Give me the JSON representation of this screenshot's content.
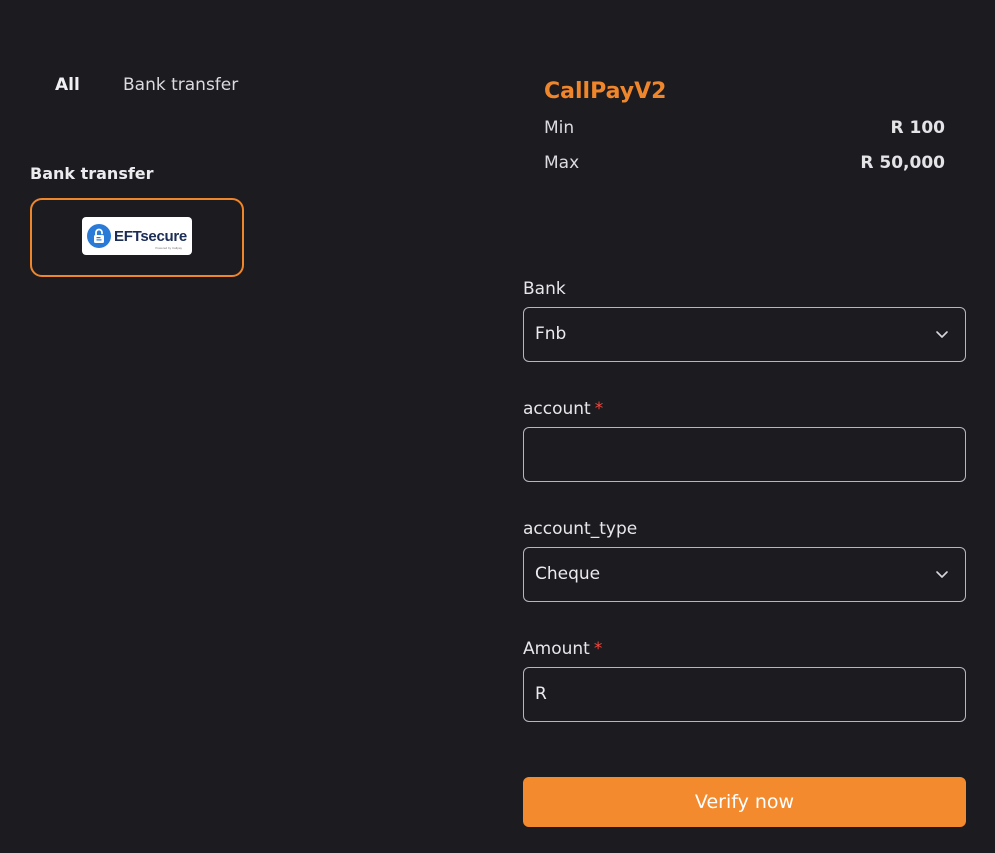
{
  "tabs": [
    {
      "label": "All"
    },
    {
      "label": "Bank transfer"
    }
  ],
  "methods_section": {
    "heading": "Bank transfer",
    "selected_method": {
      "logo_text": "EFTsecure",
      "logo_subtext": "Powered by Callpay"
    }
  },
  "provider": {
    "name": "CallPayV2",
    "min_label": "Min",
    "min_value": "R 100",
    "max_label": "Max",
    "max_value": "R 50,000"
  },
  "form": {
    "bank_label": "Bank",
    "bank_value": "Fnb",
    "account_label": "account",
    "account_required": "*",
    "account_value": "",
    "account_type_label": "account_type",
    "account_type_value": "Cheque",
    "amount_label": "Amount",
    "amount_required": "*",
    "amount_value": "R",
    "submit_label": "Verify now"
  },
  "colors": {
    "background": "#1c1b20",
    "accent": "#f0862b",
    "button": "#f48a2e",
    "required": "#f0483e",
    "logo_blue": "#2a7ad8"
  },
  "icons": [
    "lock-icon",
    "chevron-down-icon"
  ]
}
